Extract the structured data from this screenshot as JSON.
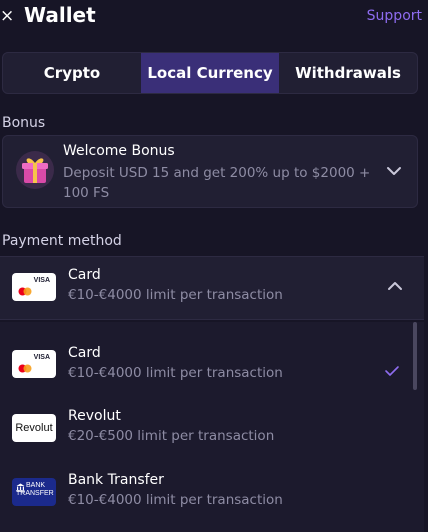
{
  "header": {
    "close_icon": "×",
    "title": "Wallet",
    "support_label": "Support"
  },
  "tabs": [
    {
      "label": "Crypto",
      "active": false
    },
    {
      "label": "Local Currency",
      "active": true
    },
    {
      "label": "Withdrawals",
      "active": false
    }
  ],
  "bonus": {
    "section_label": "Bonus",
    "title": "Welcome Bonus",
    "description": "Deposit USD 15 and get 200% up to $2000 + 100 FS",
    "icon": "gift-icon"
  },
  "payment": {
    "section_label": "Payment method",
    "selected": {
      "name": "Card",
      "limit": "€10-€4000 limit per transaction",
      "logo_text": "VISA"
    },
    "options": [
      {
        "name": "Card",
        "limit": "€10-€4000 limit per transaction",
        "logo": "visa-mastercard",
        "logo_text": "VISA",
        "checked": true
      },
      {
        "name": "Revolut",
        "limit": "€20-€500 limit per transaction",
        "logo": "revolut",
        "logo_text": "Revolut",
        "checked": false
      },
      {
        "name": "Bank Transfer",
        "limit": "€10-€4000 limit per transaction",
        "logo": "bank-transfer",
        "logo_text_line1": "BANK",
        "logo_text_line2": "TRANSFER",
        "checked": false
      }
    ]
  },
  "colors": {
    "background": "#171526",
    "card": "#211f33",
    "accent": "#8e6cf0",
    "active_tab": "#3a2f78",
    "muted_text": "#8e8ca4"
  }
}
